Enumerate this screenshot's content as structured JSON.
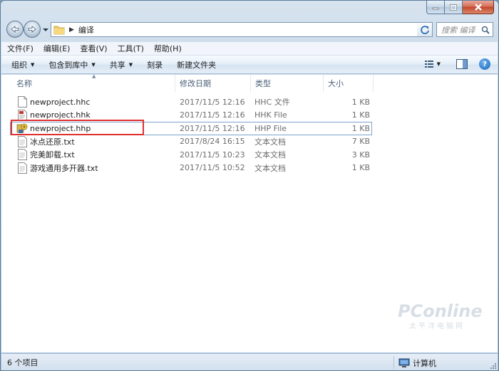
{
  "window": {
    "breadcrumb": "编译",
    "search_placeholder": "搜索 编译"
  },
  "menu": [
    "文件(F)",
    "编辑(E)",
    "查看(V)",
    "工具(T)",
    "帮助(H)"
  ],
  "commands": {
    "organize": "组织",
    "include_library": "包含到库中",
    "share": "共享",
    "burn": "刻录",
    "new_folder": "新建文件夹"
  },
  "columns": {
    "name": "名称",
    "date": "修改日期",
    "type": "类型",
    "size": "大小"
  },
  "files": [
    {
      "name": "newproject.hhc",
      "date": "2017/11/5 12:16",
      "type": "HHC 文件",
      "size": "1 KB",
      "icon": "document-icon"
    },
    {
      "name": "newproject.hhk",
      "date": "2017/11/5 12:16",
      "type": "HHK File",
      "size": "1 KB",
      "icon": "hhk-file-icon"
    },
    {
      "name": "newproject.hhp",
      "date": "2017/11/5 12:16",
      "type": "HHP File",
      "size": "1 KB",
      "icon": "html-help-project-icon"
    },
    {
      "name": "冰点还原.txt",
      "date": "2017/8/24 16:15",
      "type": "文本文档",
      "size": "7 KB",
      "icon": "text-file-icon"
    },
    {
      "name": "完美卸载.txt",
      "date": "2017/11/5 10:23",
      "type": "文本文档",
      "size": "3 KB",
      "icon": "text-file-icon"
    },
    {
      "name": "游戏通用多开器.txt",
      "date": "2017/11/5 10:52",
      "type": "文本文档",
      "size": "1 KB",
      "icon": "text-file-icon"
    }
  ],
  "highlight_color": "#e0302c",
  "status": {
    "count": "6 个项目",
    "location": "计算机"
  },
  "watermark": {
    "brand": "PConline",
    "sub": "太平洋电脑网"
  }
}
